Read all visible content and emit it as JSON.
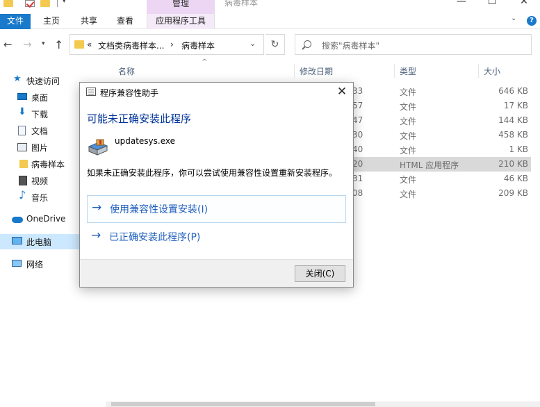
{
  "titlebar": {
    "manage_label": "管理",
    "window_title": "病毒样本",
    "minimize": "—",
    "maximize": "☐",
    "close": "✕"
  },
  "ribbon": {
    "tabs": [
      {
        "label": "文件"
      },
      {
        "label": "主页"
      },
      {
        "label": "共享"
      },
      {
        "label": "查看"
      },
      {
        "label": "应用程序工具"
      }
    ],
    "help": "?"
  },
  "address": {
    "prefix": "«",
    "crumbs": [
      "文档类病毒样本...",
      "病毒样本"
    ],
    "separator": "›"
  },
  "search": {
    "placeholder": "搜索\"病毒样本\""
  },
  "sidebar": {
    "items": [
      {
        "label": "快速访问",
        "icon": "star-icon"
      },
      {
        "label": "桌面",
        "icon": "desktop-icon"
      },
      {
        "label": "下载",
        "icon": "download-icon"
      },
      {
        "label": "文档",
        "icon": "document-icon"
      },
      {
        "label": "图片",
        "icon": "picture-icon"
      },
      {
        "label": "病毒样本",
        "icon": "folder-icon"
      },
      {
        "label": "视频",
        "icon": "video-icon"
      },
      {
        "label": "音乐",
        "icon": "music-icon"
      },
      {
        "label": "OneDrive",
        "icon": "cloud-icon"
      },
      {
        "label": "此电脑",
        "icon": "computer-icon"
      },
      {
        "label": "网络",
        "icon": "network-icon"
      }
    ]
  },
  "file_list": {
    "columns": {
      "name": "名称",
      "date": "修改日期",
      "type": "类型",
      "size": "大小"
    },
    "rows": [
      {
        "date": "33",
        "type": "文件",
        "size": "646 KB"
      },
      {
        "date": "57",
        "type": "文件",
        "size": "17 KB"
      },
      {
        "date": "47",
        "type": "文件",
        "size": "144 KB"
      },
      {
        "date": "30",
        "type": "文件",
        "size": "458 KB"
      },
      {
        "date": "40",
        "type": "文件",
        "size": "1 KB"
      },
      {
        "date": "20",
        "type": "HTML 应用程序",
        "size": "210 KB"
      },
      {
        "date": "31",
        "type": "文件",
        "size": "46 KB"
      },
      {
        "date": "08",
        "type": "文件",
        "size": "209 KB"
      }
    ]
  },
  "dialog": {
    "title": "程序兼容性助手",
    "close": "✕",
    "heading": "可能未正确安装此程序",
    "app_name": "updatesys.exe",
    "description": "如果未正确安装此程序，你可以尝试使用兼容性设置重新安装程序。",
    "option_1": "使用兼容性设置安装(I)",
    "option_2": "已正确安装此程序(P)",
    "arrow": "→",
    "close_button": "关闭(C)"
  }
}
